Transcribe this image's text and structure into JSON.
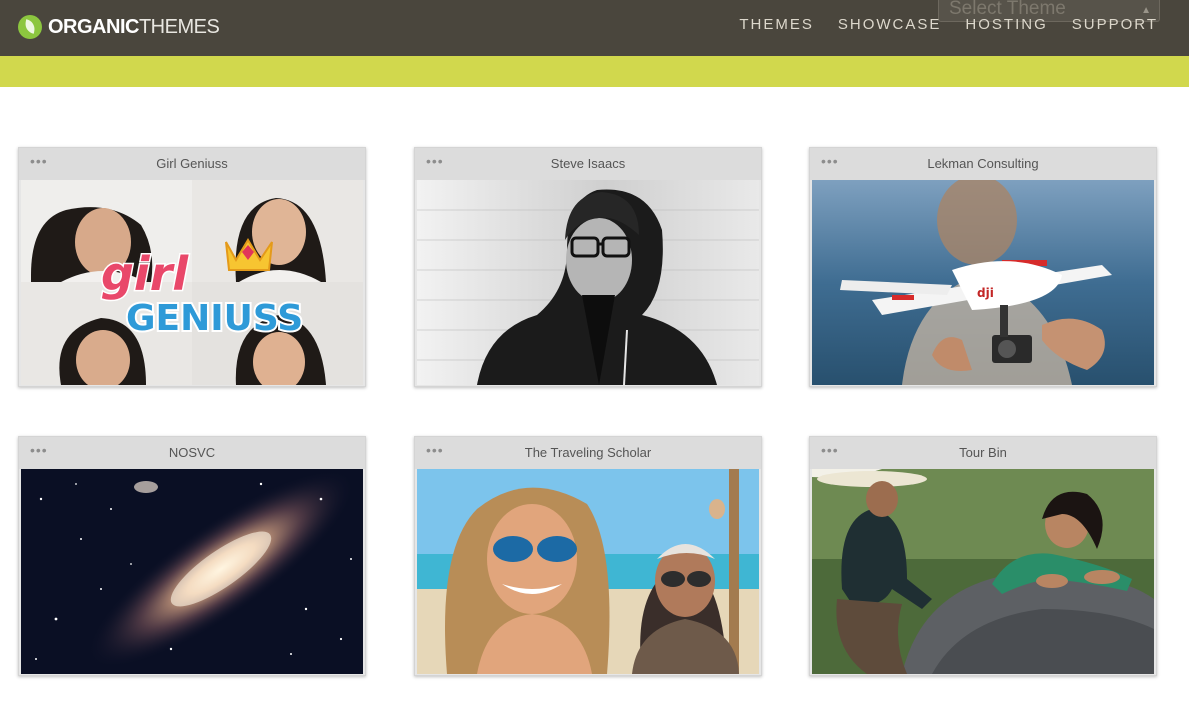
{
  "header": {
    "logo_bold": "ORGANIC",
    "logo_light": "THEMES",
    "select_placeholder": "Select Theme",
    "nav": [
      "THEMES",
      "SHOWCASE",
      "HOSTING",
      "SUPPORT"
    ]
  },
  "colors": {
    "topbar": "#4a463d",
    "accent_bar": "#d1d84d",
    "leaf": "#8cc63f"
  },
  "showcase": {
    "cards": [
      {
        "title": "Girl Geniuss",
        "dots": "•••",
        "logo_line1": "girl",
        "logo_line2": "GENIUSS"
      },
      {
        "title": "Steve Isaacs",
        "dots": "•••"
      },
      {
        "title": "Lekman Consulting",
        "dots": "•••",
        "drone_brand": "dji"
      },
      {
        "title": "NOSVC",
        "dots": "•••"
      },
      {
        "title": "The Traveling Scholar",
        "dots": "•••"
      },
      {
        "title": "Tour Bin",
        "dots": "•••"
      }
    ]
  }
}
